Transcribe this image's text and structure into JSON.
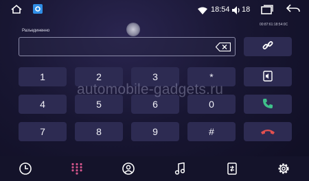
{
  "status_bar": {
    "time": "18:54",
    "volume": "18",
    "icons": [
      "home-icon",
      "app-icon",
      "wifi-icon",
      "volume-icon",
      "recent-apps-icon",
      "back-icon"
    ]
  },
  "dialer": {
    "connection_status": "Разъединенно",
    "device_address": "00:87:61:18:54:0C",
    "number_input_value": "",
    "keys": [
      {
        "label": "1",
        "name": "key-1"
      },
      {
        "label": "2",
        "name": "key-2"
      },
      {
        "label": "3",
        "name": "key-3"
      },
      {
        "label": "*",
        "name": "key-star"
      },
      {
        "label": "4",
        "name": "key-4"
      },
      {
        "label": "5",
        "name": "key-5"
      },
      {
        "label": "6",
        "name": "key-6"
      },
      {
        "label": "0",
        "name": "key-0"
      },
      {
        "label": "7",
        "name": "key-7"
      },
      {
        "label": "8",
        "name": "key-8"
      },
      {
        "label": "9",
        "name": "key-9"
      },
      {
        "label": "#",
        "name": "key-hash"
      }
    ]
  },
  "watermark": "automobile-gadgets.ru",
  "bottom_nav": [
    "history-icon",
    "dialpad-icon",
    "contacts-icon",
    "music-icon",
    "phone-transfer-icon",
    "settings-icon"
  ],
  "colors": {
    "call_green": "#3fc08a",
    "hangup_red": "#e2504f",
    "dialpad_active": "#d2558a",
    "key_background": "#2d2b52"
  }
}
